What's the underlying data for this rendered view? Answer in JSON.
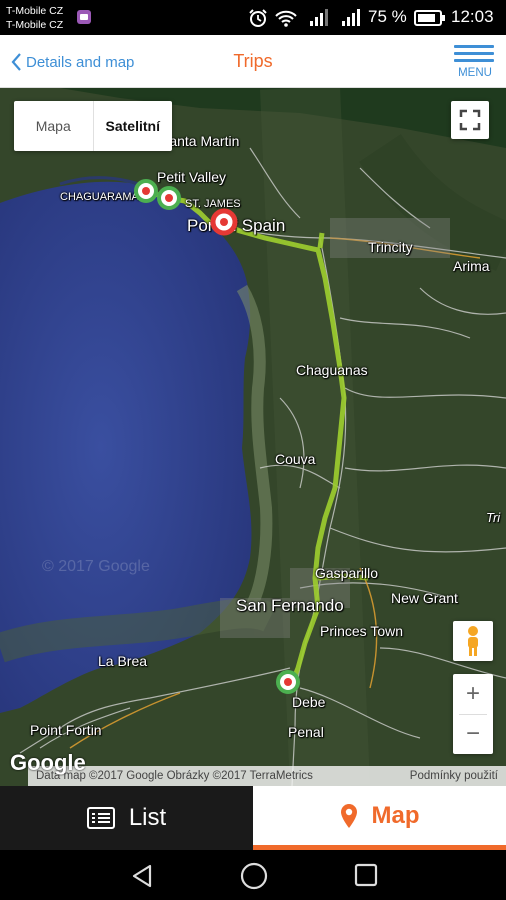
{
  "status_bar": {
    "carrier_1": "T-Mobile CZ",
    "carrier_2": "T-Mobile CZ",
    "battery_percent": "75 %",
    "time": "12:03"
  },
  "header": {
    "back_label": "Details and map",
    "title": "Trips",
    "menu_label": "MENU"
  },
  "map": {
    "map_type": {
      "option_map": "Mapa",
      "option_satellite": "Satelitní",
      "selected": "Satelitní"
    },
    "place_labels": {
      "san_martin": "Santa Martin",
      "petit_valley": "Petit Valley",
      "chaguaramas": "CHAGUARAMAS",
      "st_james": "ST. JAMES",
      "port_of_spain": "Port of Spain",
      "trincity": "Trincity",
      "arima": "Arima",
      "chaguanas": "Chaguanas",
      "couva": "Couva",
      "tri": "Tri",
      "gasparillo": "Gasparillo",
      "new_grant": "New Grant",
      "san_fernando": "San Fernando",
      "princes_town": "Princes Town",
      "la_brea": "La Brea",
      "debe": "Debe",
      "point_fortin": "Point Fortin",
      "penal": "Penal"
    },
    "watermark": "© 2017 Google",
    "google_logo": "Google",
    "attribution": "Data map ©2017 Google Obrázky ©2017 TerraMetrics",
    "terms": "Podmínky použití",
    "zoom_in": "+",
    "zoom_out": "−",
    "route_color": "#9ccc2f",
    "marker_colors": {
      "start": "#4caf50",
      "end": "#e53935"
    }
  },
  "tabs": {
    "list_label": "List",
    "map_label": "Map",
    "active": "Map",
    "accent": "#f06a2b"
  }
}
